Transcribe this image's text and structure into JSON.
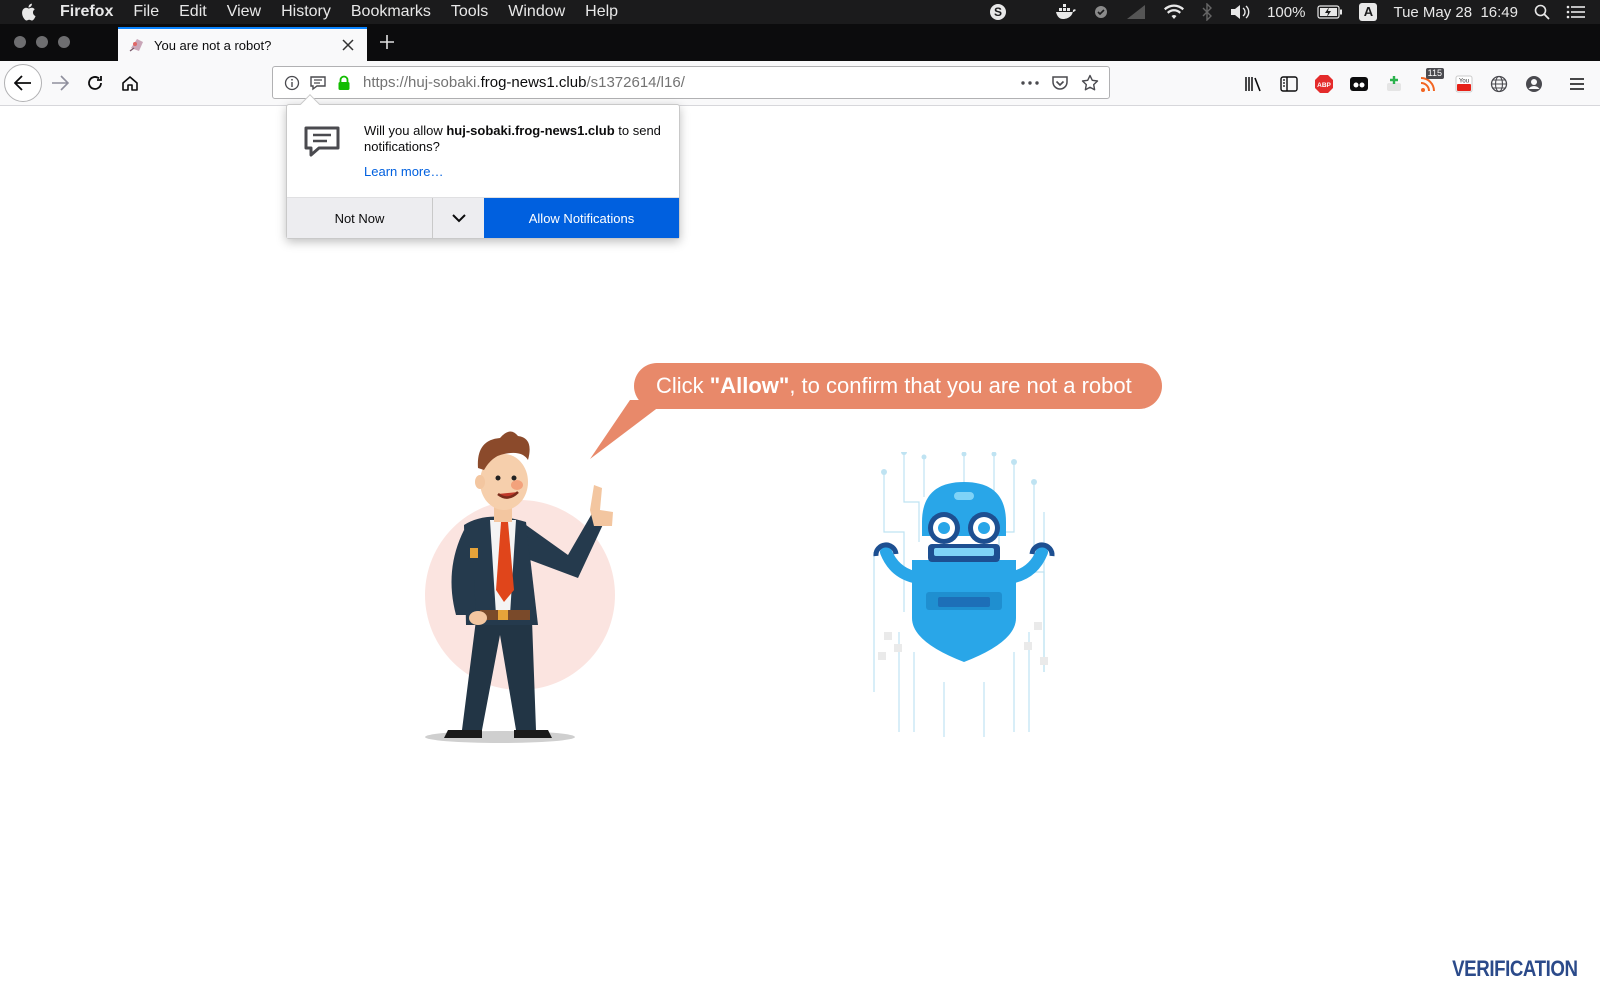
{
  "menubar": {
    "app_name": "Firefox",
    "items": [
      "File",
      "Edit",
      "View",
      "History",
      "Bookmarks",
      "Tools",
      "Window",
      "Help"
    ],
    "battery": "100%",
    "input_source": "A",
    "clock": "Tue May 28  16:49"
  },
  "tab": {
    "title": "You are not a robot?"
  },
  "urlbar": {
    "scheme_prefix": "https://huj-sobaki.",
    "host": "frog-news1.club",
    "path": "/s1372614/l16/"
  },
  "toolbar": {
    "feed_badge": "115"
  },
  "popup": {
    "message_before": "Will you allow ",
    "message_host": "huj-sobaki.frog-news1.club",
    "message_after": " to send notifications?",
    "learn_more": "Learn more…",
    "not_now": "Not Now",
    "allow": "Allow Notifications"
  },
  "page": {
    "bubble_before": "Click ",
    "bubble_strong": "\"Allow\"",
    "bubble_after": ", to confirm that you are not a robot",
    "footer_brand": "VERIFICATION"
  },
  "colors": {
    "accent": "#0060df",
    "bubble": "#e8896a",
    "brand": "#2b4a8a"
  }
}
